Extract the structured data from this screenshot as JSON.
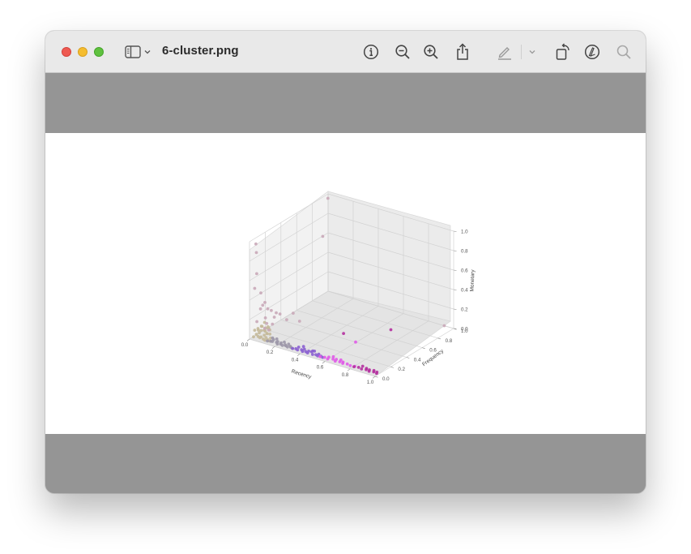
{
  "window": {
    "title": "6-cluster.png"
  },
  "toolbar": {
    "items": [
      {
        "name": "sidebar-toggle-icon"
      },
      {
        "name": "chevron-down-icon"
      },
      {
        "name": "info-icon"
      },
      {
        "name": "zoom-out-icon"
      },
      {
        "name": "zoom-in-icon"
      },
      {
        "name": "share-icon"
      },
      {
        "name": "highlight-pen-icon"
      },
      {
        "name": "chevron-down-icon"
      },
      {
        "name": "rotate-icon"
      },
      {
        "name": "markup-icon"
      },
      {
        "name": "search-icon"
      }
    ]
  },
  "chart_data": {
    "type": "scatter",
    "projection": "3d",
    "xlabel": "Recency",
    "ylabel": "Frequency",
    "zlabel": "Monetary",
    "xlim": [
      0.0,
      1.0
    ],
    "ylim": [
      0.0,
      1.0
    ],
    "zlim": [
      0.0,
      1.0
    ],
    "x_ticks": [
      "0.0",
      "0.2",
      "0.4",
      "0.6",
      "0.8",
      "1.0"
    ],
    "y_ticks": [
      "0.0",
      "0.2",
      "0.4",
      "0.6",
      "0.8",
      "1.0"
    ],
    "z_ticks": [
      "0.0",
      "0.2",
      "0.4",
      "0.6",
      "0.8",
      "1.0"
    ],
    "grid": true,
    "clusters": [
      {
        "color": "#c4b99a",
        "points": [
          [
            0.02,
            0.02,
            0.02
          ],
          [
            0.03,
            0.04,
            0.04
          ],
          [
            0.05,
            0.03,
            0.03
          ],
          [
            0.04,
            0.06,
            0.05
          ],
          [
            0.06,
            0.05,
            0.02
          ],
          [
            0.02,
            0.08,
            0.06
          ],
          [
            0.07,
            0.02,
            0.03
          ],
          [
            0.03,
            0.1,
            0.05
          ],
          [
            0.08,
            0.06,
            0.04
          ],
          [
            0.05,
            0.12,
            0.04
          ],
          [
            0.09,
            0.03,
            0.02
          ],
          [
            0.04,
            0.14,
            0.06
          ],
          [
            0.1,
            0.05,
            0.03
          ],
          [
            0.06,
            0.09,
            0.07
          ],
          [
            0.11,
            0.02,
            0.02
          ],
          [
            0.03,
            0.06,
            0.09
          ],
          [
            0.07,
            0.11,
            0.03
          ],
          [
            0.12,
            0.04,
            0.02
          ],
          [
            0.05,
            0.16,
            0.05
          ],
          [
            0.02,
            0.12,
            0.08
          ],
          [
            0.09,
            0.08,
            0.05
          ],
          [
            0.04,
            0.18,
            0.04
          ],
          [
            0.13,
            0.06,
            0.03
          ],
          [
            0.06,
            0.14,
            0.08
          ],
          [
            0.01,
            0.05,
            0.07
          ],
          [
            0.08,
            0.13,
            0.06
          ],
          [
            0.1,
            0.1,
            0.04
          ],
          [
            0.02,
            0.16,
            0.1
          ],
          [
            0.14,
            0.03,
            0.02
          ],
          [
            0.05,
            0.08,
            0.11
          ]
        ]
      },
      {
        "color": "#9c97a8",
        "points": [
          [
            0.13,
            0.02,
            0.02
          ],
          [
            0.15,
            0.03,
            0.02
          ],
          [
            0.17,
            0.02,
            0.03
          ],
          [
            0.19,
            0.04,
            0.02
          ],
          [
            0.21,
            0.02,
            0.02
          ],
          [
            0.16,
            0.05,
            0.03
          ],
          [
            0.23,
            0.03,
            0.02
          ],
          [
            0.18,
            0.06,
            0.04
          ],
          [
            0.25,
            0.02,
            0.02
          ],
          [
            0.2,
            0.04,
            0.03
          ],
          [
            0.27,
            0.03,
            0.02
          ],
          [
            0.22,
            0.05,
            0.02
          ],
          [
            0.29,
            0.02,
            0.02
          ],
          [
            0.14,
            0.07,
            0.03
          ],
          [
            0.24,
            0.06,
            0.03
          ],
          [
            0.31,
            0.03,
            0.02
          ],
          [
            0.26,
            0.04,
            0.02
          ],
          [
            0.33,
            0.02,
            0.02
          ],
          [
            0.28,
            0.05,
            0.03
          ],
          [
            0.3,
            0.04,
            0.02
          ]
        ]
      },
      {
        "color": "#8a5fd0",
        "points": [
          [
            0.33,
            0.02,
            0.02
          ],
          [
            0.35,
            0.03,
            0.02
          ],
          [
            0.37,
            0.02,
            0.02
          ],
          [
            0.39,
            0.04,
            0.02
          ],
          [
            0.41,
            0.02,
            0.02
          ],
          [
            0.43,
            0.03,
            0.02
          ],
          [
            0.45,
            0.02,
            0.02
          ],
          [
            0.47,
            0.04,
            0.03
          ],
          [
            0.49,
            0.02,
            0.02
          ],
          [
            0.51,
            0.03,
            0.02
          ],
          [
            0.53,
            0.02,
            0.02
          ],
          [
            0.36,
            0.05,
            0.03
          ],
          [
            0.4,
            0.06,
            0.02
          ],
          [
            0.44,
            0.05,
            0.02
          ],
          [
            0.48,
            0.06,
            0.03
          ],
          [
            0.52,
            0.05,
            0.02
          ],
          [
            0.55,
            0.03,
            0.02
          ],
          [
            0.46,
            0.07,
            0.02
          ],
          [
            0.57,
            0.02,
            0.02
          ],
          [
            0.38,
            0.08,
            0.03
          ]
        ]
      },
      {
        "color": "#e05be8",
        "points": [
          [
            0.55,
            0.02,
            0.02
          ],
          [
            0.58,
            0.03,
            0.02
          ],
          [
            0.61,
            0.02,
            0.02
          ],
          [
            0.64,
            0.04,
            0.02
          ],
          [
            0.67,
            0.02,
            0.02
          ],
          [
            0.6,
            0.05,
            0.02
          ],
          [
            0.7,
            0.03,
            0.02
          ],
          [
            0.73,
            0.02,
            0.02
          ],
          [
            0.63,
            0.06,
            0.03
          ],
          [
            0.76,
            0.03,
            0.02
          ],
          [
            0.66,
            0.05,
            0.02
          ],
          [
            0.79,
            0.02,
            0.02
          ],
          [
            0.69,
            0.06,
            0.02
          ],
          [
            0.72,
            0.04,
            0.02
          ],
          [
            0.62,
            0.36,
            0.03
          ],
          [
            0.82,
            0.03,
            0.02
          ]
        ]
      },
      {
        "color": "#b4309e",
        "points": [
          [
            0.82,
            0.02,
            0.02
          ],
          [
            0.85,
            0.03,
            0.02
          ],
          [
            0.88,
            0.02,
            0.02
          ],
          [
            0.91,
            0.03,
            0.02
          ],
          [
            0.94,
            0.02,
            0.02
          ],
          [
            0.97,
            0.03,
            0.02
          ],
          [
            1.0,
            0.02,
            0.02
          ],
          [
            0.99,
            0.04,
            0.02
          ],
          [
            0.96,
            0.05,
            0.02
          ],
          [
            0.9,
            0.05,
            0.02
          ],
          [
            0.93,
            0.04,
            0.02
          ],
          [
            0.87,
            0.05,
            0.03
          ],
          [
            0.7,
            0.68,
            0.03
          ],
          [
            0.48,
            0.43,
            0.03
          ]
        ]
      },
      {
        "color": "#c9a9b8",
        "points": [
          [
            0.02,
            0.05,
            0.96
          ],
          [
            0.03,
            0.04,
            0.88
          ],
          [
            0.02,
            0.06,
            0.65
          ],
          [
            0.01,
            0.05,
            0.5
          ],
          [
            0.04,
            0.08,
            0.45
          ],
          [
            0.06,
            0.1,
            0.35
          ],
          [
            0.05,
            0.06,
            0.3
          ],
          [
            0.03,
            0.12,
            0.3
          ],
          [
            0.08,
            0.15,
            0.25
          ],
          [
            0.02,
            0.2,
            0.22
          ],
          [
            0.07,
            0.09,
            0.2
          ],
          [
            0.1,
            0.18,
            0.22
          ],
          [
            0.04,
            0.03,
            0.18
          ],
          [
            0.12,
            0.1,
            0.15
          ],
          [
            0.06,
            0.22,
            0.14
          ],
          [
            0.09,
            0.05,
            0.12
          ],
          [
            0.14,
            0.25,
            0.13
          ],
          [
            0.05,
            0.14,
            0.11
          ],
          [
            0.11,
            0.07,
            0.1
          ],
          [
            0.16,
            0.3,
            0.18
          ],
          [
            0.08,
            0.26,
            0.16
          ],
          [
            0.03,
            0.95,
            0.99
          ],
          [
            0.02,
            0.9,
            0.62
          ],
          [
            0.95,
            0.96,
            0.03
          ],
          [
            0.18,
            0.35,
            0.08
          ]
        ]
      }
    ]
  }
}
